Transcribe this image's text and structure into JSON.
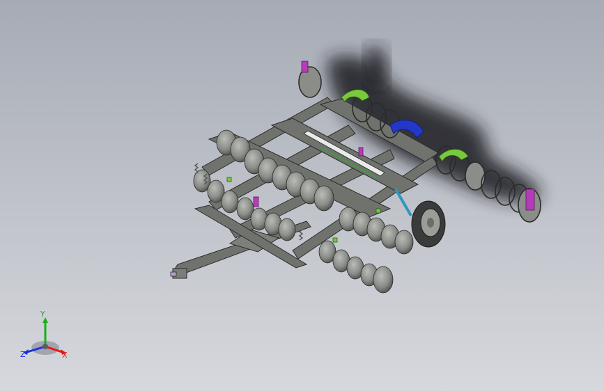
{
  "viewport": {
    "background_top": "#a6abb5",
    "background_bottom": "#d7d8de"
  },
  "model": {
    "part_colors": {
      "frame": "#6f726d",
      "disc": "#8a8d88",
      "spring": "#55585a",
      "shadow": "#1e1f21",
      "bracket": "#b63bb8",
      "clamp": "#78c93c",
      "cover": "#2338c8",
      "strut": "#2f97bf",
      "tube": "#e9eaea"
    }
  },
  "triad": {
    "x_label": "X",
    "y_label": "Y",
    "z_label": "Z",
    "x_color": "#e01818",
    "y_color": "#18b018",
    "z_color": "#1830e0"
  }
}
